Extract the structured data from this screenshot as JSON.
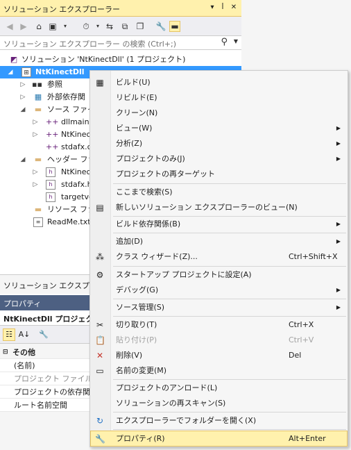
{
  "solution_explorer": {
    "title": "ソリューション エクスプローラー",
    "title_buttons": [
      "▾",
      "ꟾ",
      "✕"
    ],
    "search_placeholder": "ソリューション エクスプローラー の検索 (Ctrl+;)",
    "tree": [
      {
        "label": "ソリューション 'NtKinectDll' (1 プロジェクト)",
        "icon": "solution-icon"
      },
      {
        "label": "NtKinectDll",
        "icon": "project-icon",
        "selected": true
      },
      {
        "label": "参照",
        "icon": "references-icon"
      },
      {
        "label": "外部依存関",
        "icon": "external-deps-icon"
      },
      {
        "label": "ソース ファイル",
        "icon": "folder-icon"
      },
      {
        "label": "dllmain.",
        "icon": "cpp-file-icon"
      },
      {
        "label": "NtKinec",
        "icon": "cpp-file-icon"
      },
      {
        "label": "stdafx.c",
        "icon": "cpp-file-icon"
      },
      {
        "label": "ヘッダー ファイ",
        "icon": "folder-icon"
      },
      {
        "label": "NtKinec",
        "icon": "header-file-icon"
      },
      {
        "label": "stdafx.h",
        "icon": "header-file-icon"
      },
      {
        "label": "targetve",
        "icon": "header-file-icon"
      },
      {
        "label": "リソース ファイ",
        "icon": "folder-icon"
      },
      {
        "label": "ReadMe.txt",
        "icon": "text-file-icon"
      }
    ],
    "footer_tab": "ソリューション エクスプローラ"
  },
  "properties": {
    "title": "プロパティ",
    "object": "NtKinectDll プロジェクト(",
    "rows": [
      {
        "key": "その他",
        "category": true
      },
      {
        "key": "(名前)"
      },
      {
        "key": "プロジェクト ファイル",
        "dim": true
      },
      {
        "key": "プロジェクトの依存関係"
      },
      {
        "key": "ルート名前空間"
      }
    ]
  },
  "context_menu": {
    "items": [
      {
        "label": "ビルド(U)",
        "icon": "build-icon"
      },
      {
        "label": "リビルド(E)"
      },
      {
        "label": "クリーン(N)"
      },
      {
        "label": "ビュー(W)",
        "submenu": true
      },
      {
        "label": "分析(Z)",
        "submenu": true
      },
      {
        "label": "プロジェクトのみ(J)",
        "submenu": true
      },
      {
        "label": "プロジェクトの再ターゲット"
      },
      {
        "label": "ここまで検索(S)"
      },
      {
        "label": "新しいソリューション エクスプローラーのビュー(N)",
        "icon": "new-view-icon"
      },
      {
        "label": "ビルド依存関係(B)",
        "submenu": true
      },
      {
        "label": "追加(D)",
        "submenu": true
      },
      {
        "label": "クラス ウィザード(Z)...",
        "shortcut": "Ctrl+Shift+X",
        "icon": "class-wizard-icon"
      },
      {
        "label": "スタートアップ プロジェクトに設定(A)",
        "icon": "gear-icon"
      },
      {
        "label": "デバッグ(G)",
        "submenu": true
      },
      {
        "label": "ソース管理(S)",
        "submenu": true
      },
      {
        "label": "切り取り(T)",
        "shortcut": "Ctrl+X",
        "icon": "scissors-icon"
      },
      {
        "label": "貼り付け(P)",
        "shortcut": "Ctrl+V",
        "icon": "paste-icon",
        "disabled": true
      },
      {
        "label": "削除(V)",
        "shortcut": "Del",
        "icon": "delete-icon"
      },
      {
        "label": "名前の変更(M)",
        "icon": "rename-icon"
      },
      {
        "label": "プロジェクトのアンロード(L)"
      },
      {
        "label": "ソリューションの再スキャン(S)"
      },
      {
        "label": "エクスプローラーでフォルダーを開く(X)",
        "icon": "refresh-arrow-icon"
      },
      {
        "label": "プロパティ(R)",
        "shortcut": "Alt+Enter",
        "icon": "wrench-icon",
        "highlighted": true
      }
    ]
  },
  "colors": {
    "accent_title": "#fff1ad",
    "selection": "#3399ff",
    "properties_title": "#4d6082"
  }
}
